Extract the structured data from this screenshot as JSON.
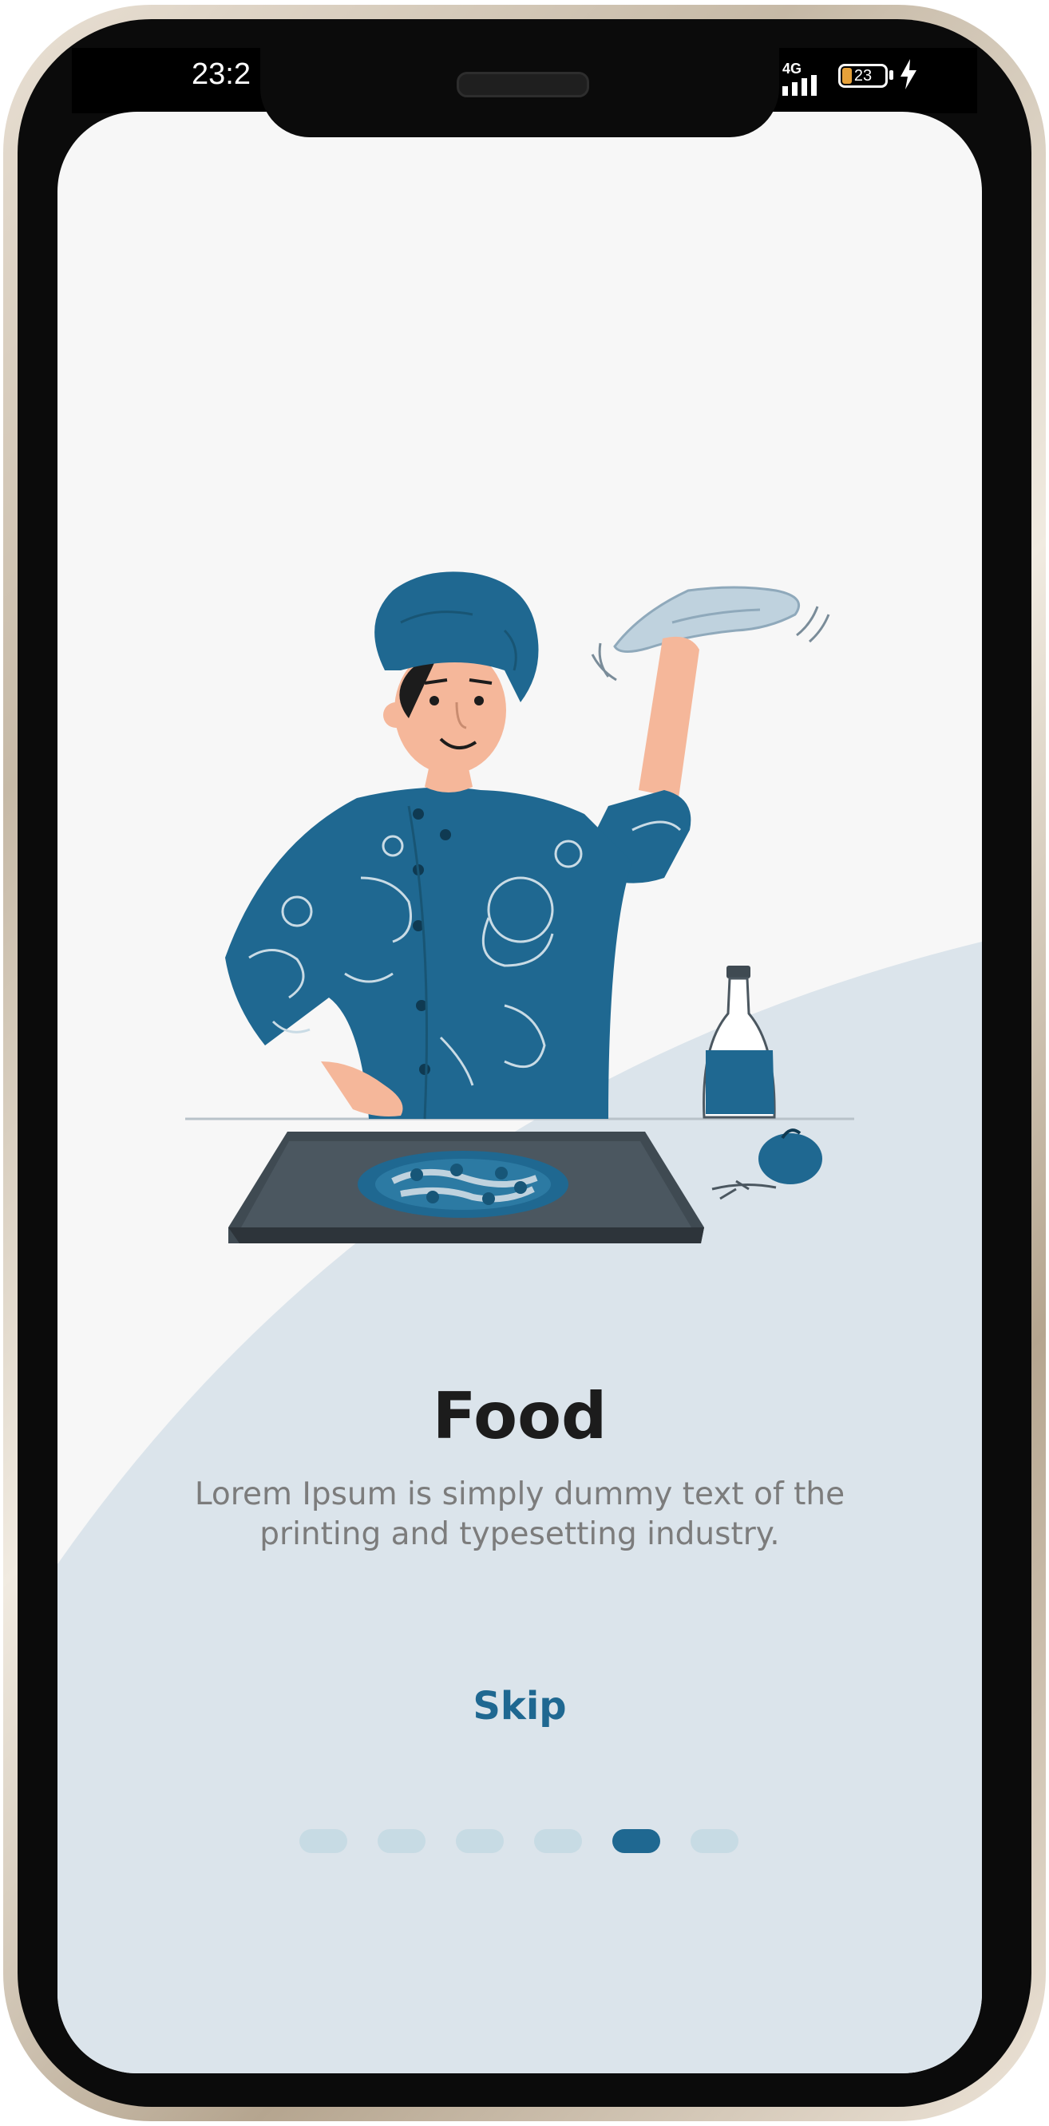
{
  "status_bar": {
    "time": "23:2",
    "network": "4G",
    "battery_level": "23",
    "battery_fraction": 0.23
  },
  "colors": {
    "accent": "#1f6891",
    "background": "#f7f7f7",
    "wave": "#dbe4eb",
    "dot_inactive": "#c7dbe4"
  },
  "onboarding": {
    "title": "Food",
    "description": "Lorem Ipsum is simply dummy text of the printing and typesetting industry.",
    "skip_label": "Skip",
    "page_count": 6,
    "current_page": 5
  },
  "icons": [
    "signal-icon",
    "battery-icon",
    "charging-icon",
    "chef-illustration"
  ]
}
